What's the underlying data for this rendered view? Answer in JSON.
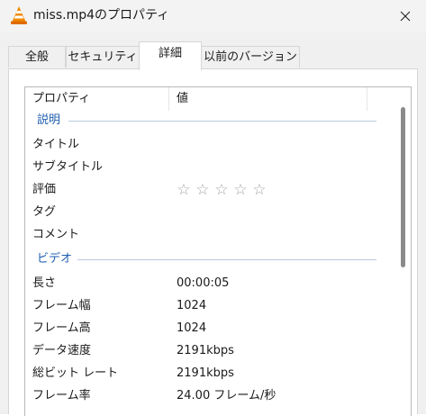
{
  "window": {
    "title": "miss.mp4のプロパティ",
    "app_icon": "vlc-cone-icon",
    "close_icon": "close-icon"
  },
  "tabs": [
    {
      "label": "全般",
      "active": false
    },
    {
      "label": "セキュリティ",
      "active": false
    },
    {
      "label": "詳細",
      "active": true
    },
    {
      "label": "以前のバージョン",
      "active": false
    }
  ],
  "list": {
    "columns": {
      "property": "プロパティ",
      "value": "値"
    },
    "groups": {
      "description": {
        "label": "説明",
        "rows": [
          {
            "name": "タイトル",
            "value": ""
          },
          {
            "name": "サブタイトル",
            "value": ""
          },
          {
            "name": "評価",
            "rating": 0,
            "max_rating": 5
          },
          {
            "name": "タグ",
            "value": ""
          },
          {
            "name": "コメント",
            "value": ""
          }
        ]
      },
      "video": {
        "label": "ビデオ",
        "rows": [
          {
            "name": "長さ",
            "value": "00:00:05"
          },
          {
            "name": "フレーム幅",
            "value": "1024"
          },
          {
            "name": "フレーム高",
            "value": "1024"
          },
          {
            "name": "データ速度",
            "value": "2191kbps"
          },
          {
            "name": "総ビット レート",
            "value": "2191kbps"
          },
          {
            "name": "フレーム率",
            "value": "24.00 フレーム/秒"
          }
        ]
      }
    }
  },
  "star_glyph": "☆"
}
